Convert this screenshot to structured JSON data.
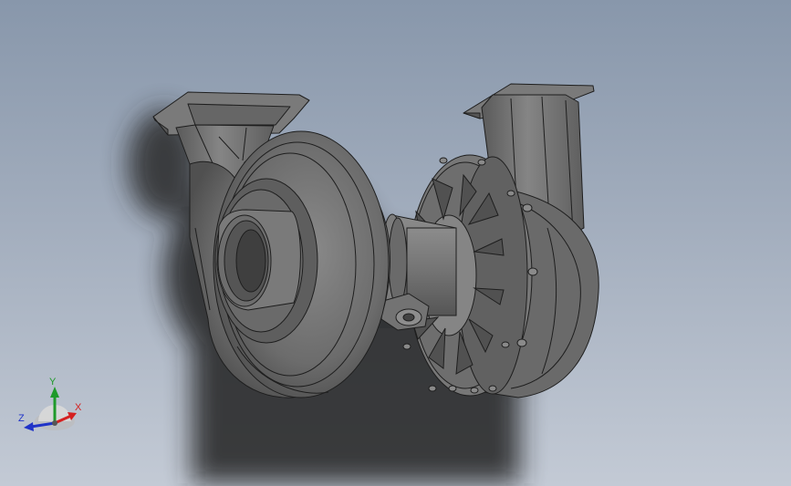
{
  "viewport": {
    "background_top": "#8897ab",
    "background_bottom": "#c3cad5"
  },
  "model": {
    "description_icon": "centrifugal-pump-assembly",
    "body_color": "#6f6f6f",
    "edge_color": "#1e1e1e"
  },
  "triad": {
    "x_label": "X",
    "y_label": "Y",
    "z_label": "Z",
    "x_color": "#d42020",
    "y_color": "#1f9a2a",
    "z_color": "#2033c8"
  }
}
